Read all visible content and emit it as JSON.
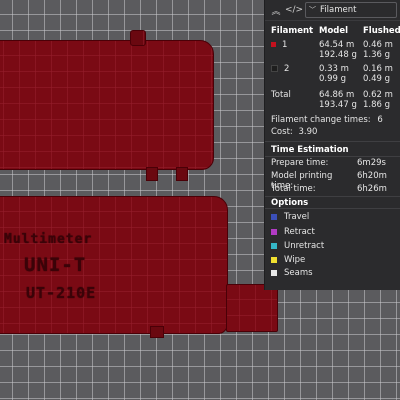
{
  "header": {
    "collapse_icon": "chevrons-up-icon",
    "code_icon": "code-icon",
    "view_select_value": "Filament"
  },
  "filament_table": {
    "headers": [
      "Filament",
      "Model",
      "Flushed"
    ],
    "rows": [
      {
        "id": "1",
        "color": "#c4111e",
        "model_length": "64.54 m",
        "model_weight": "192.48 g",
        "flushed_length": "0.46 m",
        "flushed_weight": "1.36 g"
      },
      {
        "id": "2",
        "color": "#2b2b2b",
        "model_length": "0.33 m",
        "model_weight": "0.99 g",
        "flushed_length": "0.16 m",
        "flushed_weight": "0.49 g"
      }
    ],
    "total": {
      "label": "Total",
      "model_length": "64.86 m",
      "model_weight": "193.47 g",
      "flushed_length": "0.62 m",
      "flushed_weight": "1.86 g"
    }
  },
  "filament_change": {
    "label": "Filament change times:",
    "value": "6"
  },
  "cost": {
    "label": "Cost:",
    "value": "3.90"
  },
  "time_estimation": {
    "title": "Time Estimation",
    "prepare": {
      "label": "Prepare time:",
      "value": "6m29s"
    },
    "model": {
      "label": "Model printing time:",
      "value": "6h20m"
    },
    "total": {
      "label": "Total time:",
      "value": "6h26m"
    }
  },
  "options": {
    "title": "Options",
    "items": [
      {
        "label": "Travel",
        "color": "#3b4fb8"
      },
      {
        "label": "Retract",
        "color": "#b23bc4"
      },
      {
        "label": "Unretract",
        "color": "#35b7c8"
      },
      {
        "label": "Wipe",
        "color": "#f0e030"
      },
      {
        "label": "Seams",
        "color": "#e8e8e8"
      }
    ]
  },
  "model_text": {
    "line1": "Multimeter",
    "line2": "UNI-T",
    "line3": "UT-210E"
  }
}
